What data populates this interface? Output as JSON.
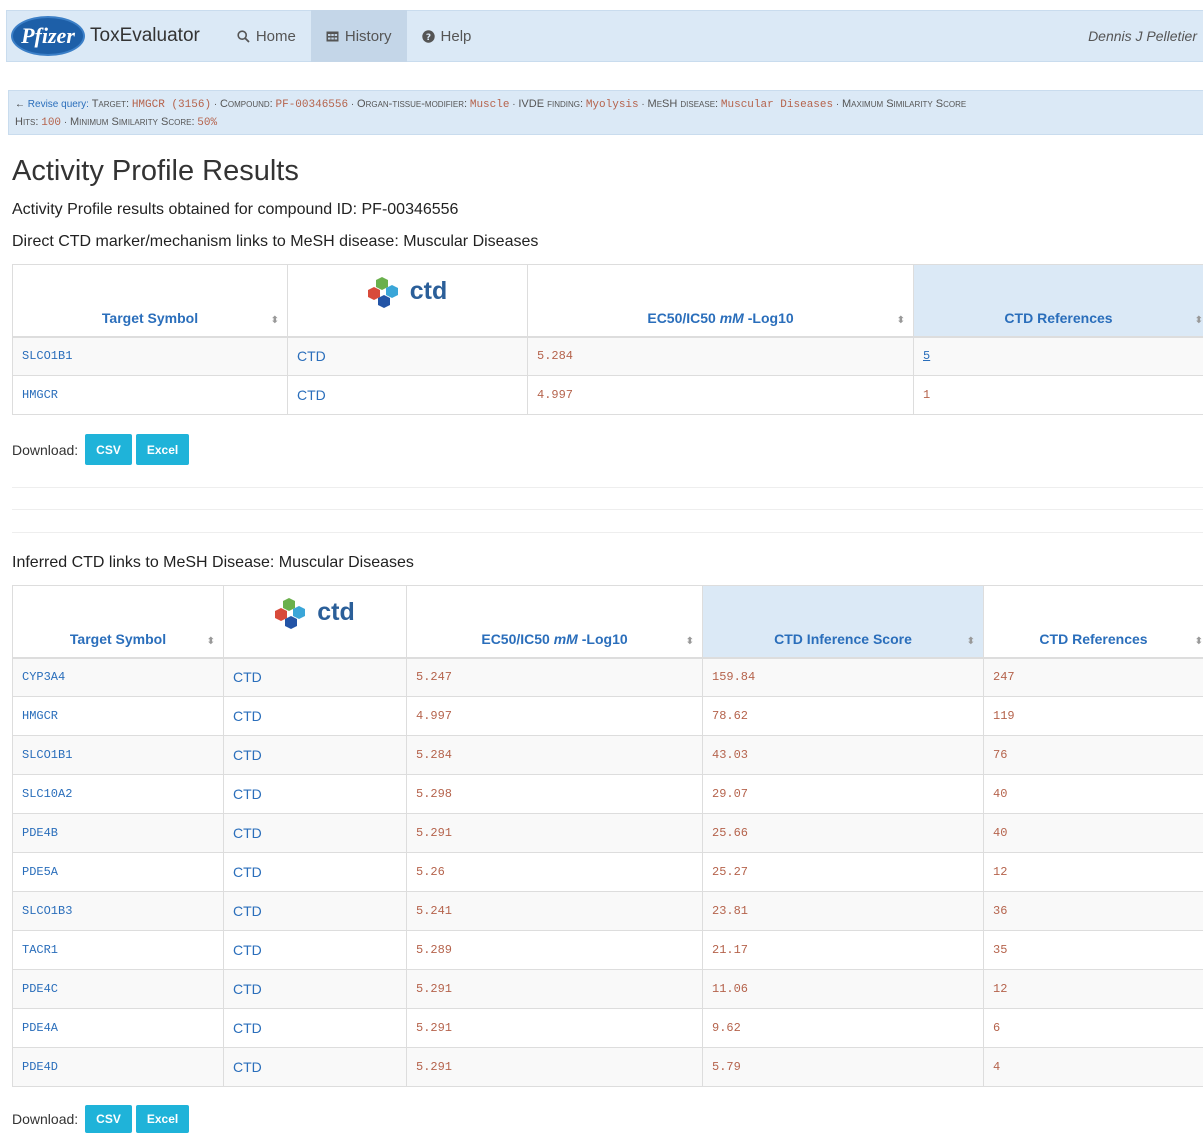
{
  "navbar": {
    "logo_text": "Pfizer",
    "brand": "ToxEvaluator",
    "items": [
      {
        "label": "Home",
        "icon": "search-icon"
      },
      {
        "label": "History",
        "icon": "calendar-icon"
      },
      {
        "label": "Help",
        "icon": "question-circle-icon"
      }
    ],
    "user": "Dennis J Pelletier"
  },
  "query": {
    "revise_label": "Revise query:",
    "target_label": "Target:",
    "target_value": "HMGCR (3156)",
    "compound_label": "Compound:",
    "compound_value": "PF-00346556",
    "organ_label": "Organ-tissue-modifier:",
    "organ_value": "Muscle",
    "ivde_label": "IVDE finding:",
    "ivde_value": "Myolysis",
    "mesh_label": "MeSH disease:",
    "mesh_value": "Muscular Diseases",
    "max_sim_label": "Maximum Similarity Score",
    "hits_label": "Hits:",
    "hits_value": "100",
    "min_sim_label": "Minimum Similarity Score:",
    "min_sim_value": "50%"
  },
  "page": {
    "title": "Activity Profile Results",
    "subtitle": "Activity Profile results obtained for compound ID: PF-00346556",
    "direct_heading": "Direct CTD marker/mechanism links to MeSH disease: Muscular Diseases",
    "inferred_heading": "Inferred CTD links to MeSH Disease: Muscular Diseases"
  },
  "ctd_logo_text": "ctd",
  "direct_table": {
    "headers": [
      "Target Symbol",
      "EC50/IC50",
      "mM",
      "-Log10",
      "CTD References"
    ],
    "rows": [
      [
        "SLCO1B1",
        "CTD",
        "5.284",
        "5"
      ],
      [
        "HMGCR",
        "CTD",
        "4.997",
        "1"
      ]
    ]
  },
  "inferred_table": {
    "headers": [
      "Target Symbol",
      "EC50/IC50",
      "mM",
      "-Log10",
      "CTD Inference Score",
      "CTD References"
    ],
    "rows": [
      [
        "CYP3A4",
        "CTD",
        "5.247",
        "159.84",
        "247"
      ],
      [
        "HMGCR",
        "CTD",
        "4.997",
        "78.62",
        "119"
      ],
      [
        "SLCO1B1",
        "CTD",
        "5.284",
        "43.03",
        "76"
      ],
      [
        "SLC10A2",
        "CTD",
        "5.298",
        "29.07",
        "40"
      ],
      [
        "PDE4B",
        "CTD",
        "5.291",
        "25.66",
        "40"
      ],
      [
        "PDE5A",
        "CTD",
        "5.26",
        "25.27",
        "12"
      ],
      [
        "SLCO1B3",
        "CTD",
        "5.241",
        "23.81",
        "36"
      ],
      [
        "TACR1",
        "CTD",
        "5.289",
        "21.17",
        "35"
      ],
      [
        "PDE4C",
        "CTD",
        "5.291",
        "11.06",
        "12"
      ],
      [
        "PDE4A",
        "CTD",
        "5.291",
        "9.62",
        "6"
      ],
      [
        "PDE4D",
        "CTD",
        "5.291",
        "5.79",
        "4"
      ]
    ]
  },
  "download": {
    "label": "Download:",
    "csv": "CSV",
    "excel": "Excel"
  },
  "colors": {
    "accent": "#2a6ebb",
    "value": "#b5634c",
    "button": "#1fb3d9",
    "header_bg": "#dbe9f6"
  }
}
